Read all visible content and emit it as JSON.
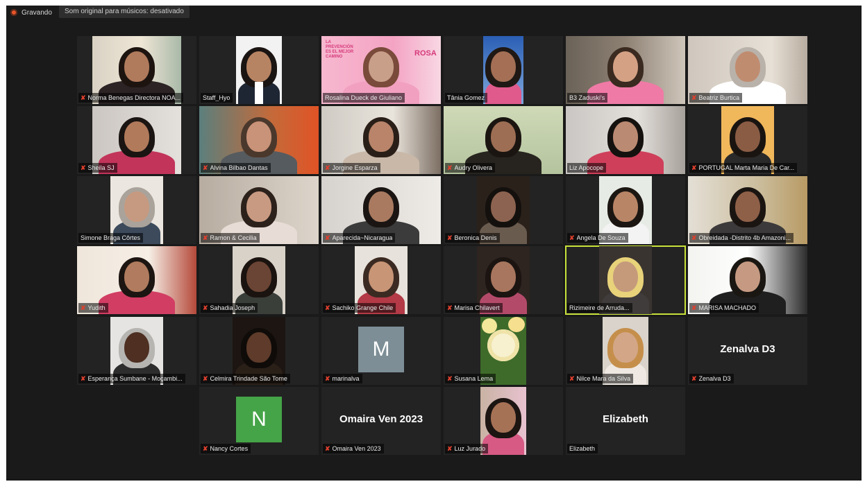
{
  "recording": {
    "label": "Gravando"
  },
  "audio_chip": {
    "label": "Som original para músicos: desativado"
  },
  "participants": [
    {
      "name": "Norma Benegas Directora NOA...",
      "type": "video",
      "mic": "muted"
    },
    {
      "name": "Staff_Hyo",
      "type": "video",
      "mic": "none"
    },
    {
      "name": "Rosalina Dueck de Giuliano",
      "type": "video",
      "mic": "none"
    },
    {
      "name": "Tânia Gomez",
      "type": "video",
      "mic": "none"
    },
    {
      "name": "B3 Zaduski's",
      "type": "video",
      "mic": "none"
    },
    {
      "name": "Beatriz Burtica",
      "type": "video",
      "mic": "muted"
    },
    {
      "name": "Sheila SJ",
      "type": "video",
      "mic": "muted"
    },
    {
      "name": "Alvina Bilbao Dantas",
      "type": "video",
      "mic": "muted"
    },
    {
      "name": "Jorgine Esparza",
      "type": "video",
      "mic": "muted"
    },
    {
      "name": "Audry Olivera",
      "type": "video",
      "mic": "muted"
    },
    {
      "name": "Liz Apocope",
      "type": "video",
      "mic": "none"
    },
    {
      "name": "PORTUGAL Marta Maria De Car...",
      "type": "video",
      "mic": "muted"
    },
    {
      "name": "Simone Braga Côrtes",
      "type": "video",
      "mic": "none"
    },
    {
      "name": "Ramon & Cecilia",
      "type": "video",
      "mic": "muted"
    },
    {
      "name": "Aparecida~Nicaragua",
      "type": "video",
      "mic": "muted"
    },
    {
      "name": "Beronica Denis",
      "type": "video",
      "mic": "muted"
    },
    {
      "name": "Angela De Souza",
      "type": "video",
      "mic": "muted"
    },
    {
      "name": "Obreidada -Distrito 4b Amazoni...",
      "type": "video",
      "mic": "muted"
    },
    {
      "name": "Yudith",
      "type": "video",
      "mic": "muted"
    },
    {
      "name": "Sahadia Joseph",
      "type": "video",
      "mic": "muted"
    },
    {
      "name": "Sachiko Grange Chile",
      "type": "video",
      "mic": "muted"
    },
    {
      "name": "Marisa Chilavert",
      "type": "video",
      "mic": "muted"
    },
    {
      "name": "Rizimeire de Arruda...",
      "type": "video",
      "mic": "none"
    },
    {
      "name": "MARISA MACHADO",
      "type": "video",
      "mic": "muted"
    },
    {
      "name": "Esperança Sumbane - Moçambi...",
      "type": "video",
      "mic": "muted"
    },
    {
      "name": "Celmira Trindade São Tome",
      "type": "video",
      "mic": "muted"
    },
    {
      "name": "marinalva",
      "type": "avatar",
      "letter": "M",
      "mic": "muted"
    },
    {
      "name": "Susana Lema",
      "type": "image",
      "mic": "muted"
    },
    {
      "name": "Nilce Mara da Silva",
      "type": "video",
      "mic": "muted"
    },
    {
      "name": "Zenalva D3",
      "type": "text",
      "big": "Zenalva D3",
      "mic": "muted"
    },
    {
      "name": "Nancy Cortes",
      "type": "avatar",
      "letter": "N",
      "mic": "muted"
    },
    {
      "name": "Omaira Ven 2023",
      "type": "text",
      "big": "Omaira Ven 2023",
      "mic": "muted"
    },
    {
      "name": "Luz Jurado",
      "type": "video",
      "mic": "muted"
    },
    {
      "name": "Elizabeth",
      "type": "text",
      "big": "Elizabeth",
      "mic": "none"
    }
  ],
  "colors": {
    "background": "#1a1a1a",
    "tile": "#232323",
    "active_speaker_border": "#c9e23a",
    "muted_mic": "#e0402e",
    "avatar_m": "#7d8e96",
    "avatar_n": "#45a447"
  },
  "banner": {
    "lines": [
      "LA",
      "PREVENCIÓN",
      "ES EL MEJOR",
      "CAMINO",
      "OCTUBRE",
      "ROSA"
    ]
  }
}
